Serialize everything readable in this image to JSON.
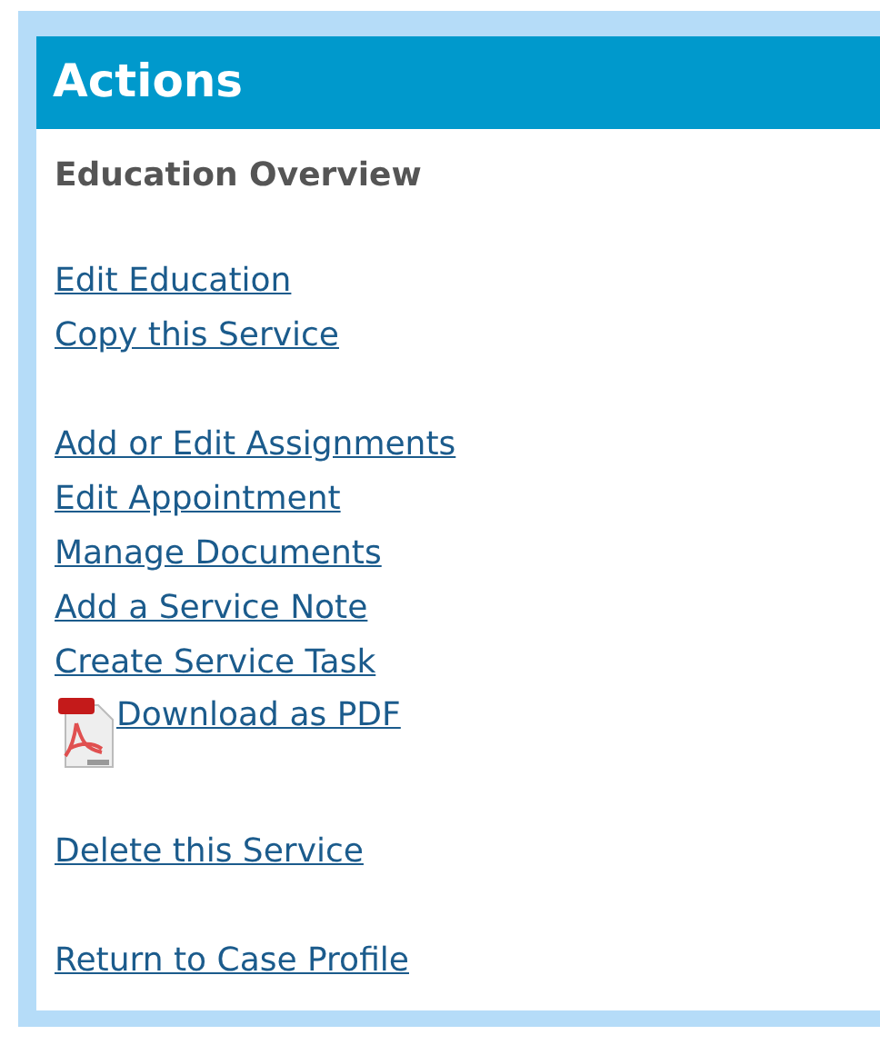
{
  "panel": {
    "title": "Actions",
    "subtitle": "Education Overview",
    "groups": [
      {
        "links": [
          {
            "label": "Edit Education",
            "kind": "link"
          },
          {
            "label": "Copy this Service",
            "kind": "link"
          }
        ]
      },
      {
        "links": [
          {
            "label": "Add or Edit Assignments",
            "kind": "link"
          },
          {
            "label": "Edit Appointment",
            "kind": "link"
          },
          {
            "label": "Manage Documents",
            "kind": "link"
          },
          {
            "label": "Add a Service Note",
            "kind": "link"
          },
          {
            "label": "Create Service Task",
            "kind": "link"
          },
          {
            "label": "Download as PDF",
            "kind": "pdf"
          }
        ]
      },
      {
        "links": [
          {
            "label": "Delete this Service",
            "kind": "link"
          }
        ]
      },
      {
        "links": [
          {
            "label": "Return to Case Profile",
            "kind": "link"
          }
        ]
      }
    ]
  }
}
